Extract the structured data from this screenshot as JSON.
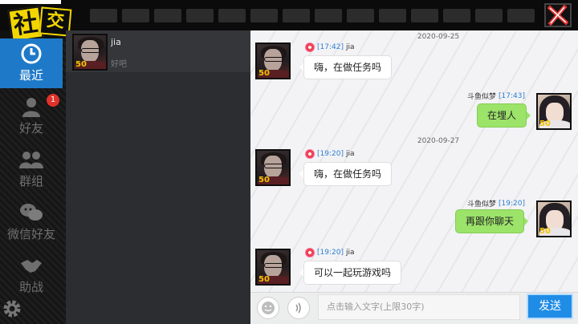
{
  "app": {
    "logo_char_1": "社",
    "logo_char_2": "交"
  },
  "nav": {
    "items": [
      {
        "label": "最近",
        "icon": "clock-icon",
        "active": true
      },
      {
        "label": "好友",
        "icon": "friend-icon",
        "badge": "1"
      },
      {
        "label": "群组",
        "icon": "group-icon"
      },
      {
        "label": "微信好友",
        "icon": "wechat-icon"
      },
      {
        "label": "助战",
        "icon": "handshake-icon"
      }
    ],
    "settings_icon": "gear-icon"
  },
  "contacts": [
    {
      "name": "jia",
      "last_message": "好吧",
      "level": "50"
    }
  ],
  "chat": {
    "messages": [
      {
        "type": "date",
        "text": "2020-09-25"
      },
      {
        "type": "in",
        "time": "[17:42]",
        "sender": "jia",
        "text": "嗨，在做任务吗",
        "level": "50"
      },
      {
        "type": "out",
        "time": "[17:43]",
        "sender": "斗鱼似梦",
        "text": "在埋人",
        "level": "50"
      },
      {
        "type": "date",
        "text": "2020-09-27"
      },
      {
        "type": "in",
        "time": "[19:20]",
        "sender": "jia",
        "text": "嗨，在做任务吗",
        "level": "50"
      },
      {
        "type": "out",
        "time": "[19:20]",
        "sender": "斗鱼似梦",
        "text": "再跟你聊天",
        "level": "50"
      },
      {
        "type": "in",
        "time": "[19:20]",
        "sender": "jia",
        "text": "可以一起玩游戏吗",
        "level": "50"
      }
    ]
  },
  "input": {
    "placeholder": "点击输入文字(上限30字)",
    "send_label": "发送"
  },
  "colors": {
    "accent": "#1e79c8",
    "my_bubble": "#9ce36a",
    "logo_yellow": "#f2d600",
    "badge_red": "#e0322b"
  }
}
